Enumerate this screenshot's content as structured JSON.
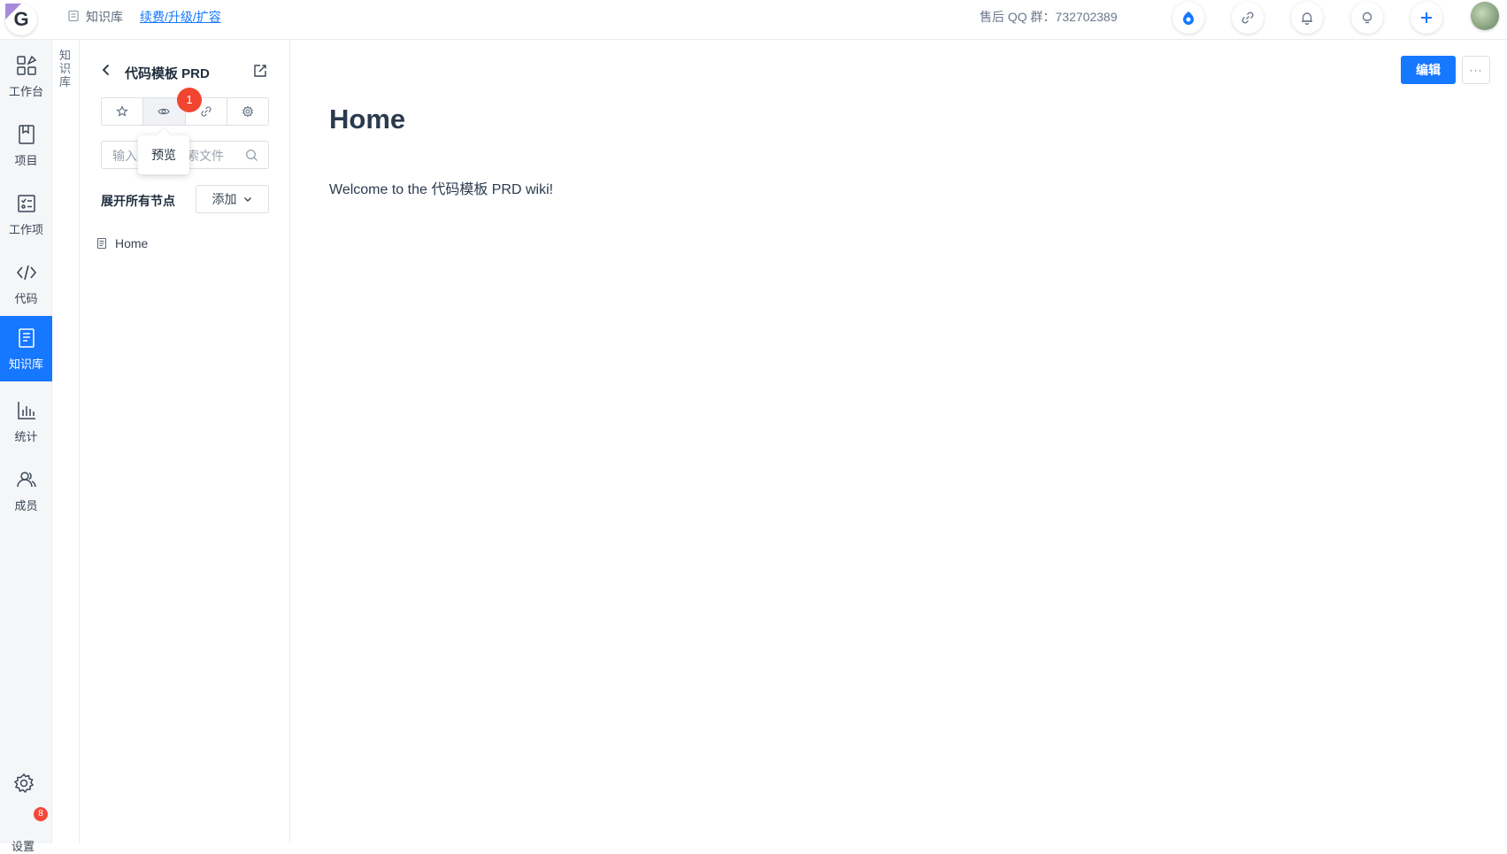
{
  "topbar": {
    "logo_letter": "G",
    "breadcrumb": "知识库",
    "upgrade_link": "续费/升级/扩容",
    "qq_group": "售后 QQ 群：732702389"
  },
  "nav": {
    "items": [
      {
        "label": "工作台",
        "icon": "dashboard-icon"
      },
      {
        "label": "项目",
        "icon": "book-icon"
      },
      {
        "label": "工作项",
        "icon": "checklist-icon"
      },
      {
        "label": "代码",
        "icon": "code-icon"
      },
      {
        "label": "知识库",
        "icon": "wiki-icon",
        "active": true
      },
      {
        "label": "统计",
        "icon": "bar-chart-icon"
      },
      {
        "label": "成员",
        "icon": "members-icon"
      }
    ],
    "settings": {
      "label": "设置",
      "badge": "8"
    }
  },
  "vstrip": {
    "label": "知识库"
  },
  "wiki_sidebar": {
    "title": "代码模板 PRD",
    "toolbar": [
      "star-icon",
      "eye-icon",
      "link-icon",
      "gear-icon"
    ],
    "step_badge": "1",
    "tooltip": "预览",
    "search_placeholder": "输入关键字搜索文件",
    "expand_all": "展开所有节点",
    "add_button": "添加",
    "tree": [
      {
        "label": "Home"
      }
    ]
  },
  "main": {
    "page_title": "Home",
    "body_text": "Welcome to the 代码模板 PRD wiki!",
    "edit_button": "编辑",
    "more_button": "···"
  },
  "colors": {
    "accent": "#1677ff",
    "badge": "#f1452f"
  }
}
